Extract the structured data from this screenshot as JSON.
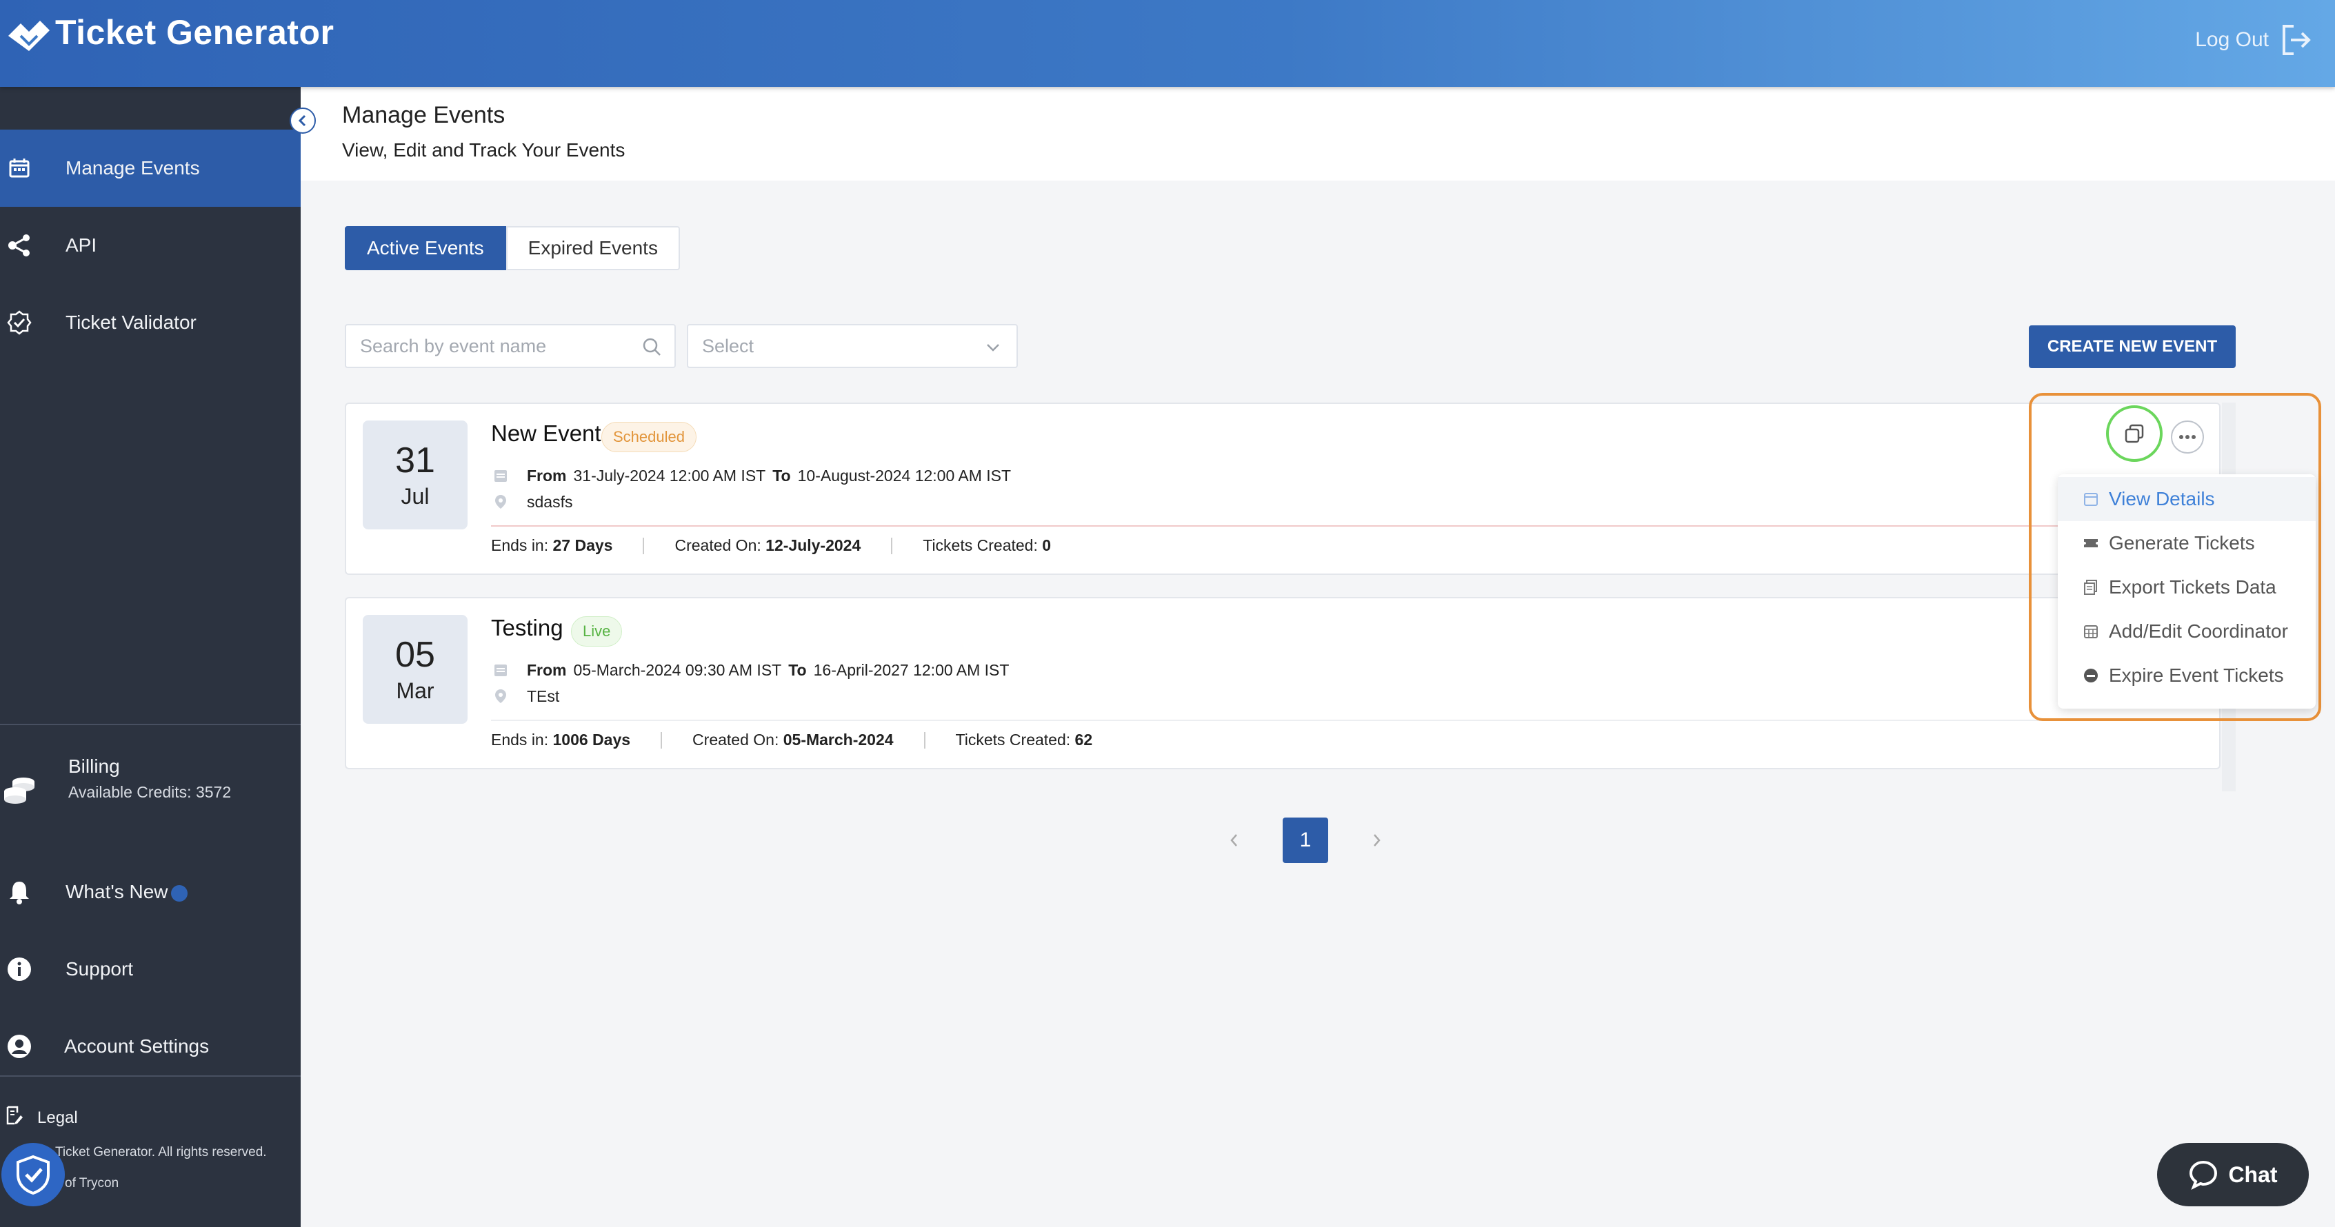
{
  "header": {
    "app_title": "Ticket Generator",
    "logout_label": "Log Out"
  },
  "sidebar": {
    "items": [
      {
        "label": "Manage Events",
        "icon": "calendar-icon",
        "active": true
      },
      {
        "label": "API",
        "icon": "share-nodes-icon",
        "active": false
      },
      {
        "label": "Ticket Validator",
        "icon": "badge-check-icon",
        "active": false
      }
    ],
    "billing": {
      "title": "Billing",
      "credits": "Available Credits: 3572",
      "icon": "coins-icon"
    },
    "bottom_items": [
      {
        "label": "What's New",
        "icon": "bell-icon"
      },
      {
        "label": "Support",
        "icon": "info-icon"
      },
      {
        "label": "Account Settings",
        "icon": "user-circle-icon"
      }
    ],
    "legal": "Legal",
    "copyright_line1": "Ticket Generator. All rights reserved.",
    "copyright_line2": "of Trycon"
  },
  "page": {
    "title": "Manage Events",
    "subtitle": "View, Edit and Track Your Events"
  },
  "tabs": [
    {
      "label": "Active Events",
      "active": true
    },
    {
      "label": "Expired Events",
      "active": false
    }
  ],
  "filters": {
    "search_placeholder": "Search by event name",
    "select_placeholder": "Select",
    "create_label": "CREATE NEW EVENT"
  },
  "events": [
    {
      "day": "31",
      "month": "Jul",
      "name": "New Event",
      "status": "Scheduled",
      "from_label": "From",
      "from": "31-July-2024 12:00 AM IST",
      "to_label": "To",
      "to": "10-August-2024 12:00 AM IST",
      "location": "sdasfs",
      "ends_label": "Ends in:",
      "ends_value": "27 Days",
      "created_label": "Created On:",
      "created_value": "12-July-2024",
      "tickets_label": "Tickets Created:",
      "tickets_value": "0"
    },
    {
      "day": "05",
      "month": "Mar",
      "name": "Testing",
      "status": "Live",
      "from_label": "From",
      "from": "05-March-2024 09:30 AM IST",
      "to_label": "To",
      "to": "16-April-2027 12:00 AM IST",
      "location": "TEst",
      "ends_label": "Ends in:",
      "ends_value": "1006 Days",
      "created_label": "Created On:",
      "created_value": "05-March-2024",
      "tickets_label": "Tickets Created:",
      "tickets_value": "62"
    }
  ],
  "action_menu": [
    {
      "label": "View Details",
      "icon": "calendar-icon",
      "highlighted": true
    },
    {
      "label": "Generate Tickets",
      "icon": "ticket-icon",
      "highlighted": false
    },
    {
      "label": "Export Tickets Data",
      "icon": "export-icon",
      "highlighted": false
    },
    {
      "label": "Add/Edit Coordinator",
      "icon": "calendar-grid-icon",
      "highlighted": false
    },
    {
      "label": "Expire Event Tickets",
      "icon": "minus-circle-icon",
      "highlighted": false
    }
  ],
  "pagination": {
    "current": "1"
  },
  "chat": {
    "label": "Chat"
  },
  "colors": {
    "primary": "#2d5ca8",
    "sidebar": "#2c3340",
    "scheduled": "#e2953b",
    "live": "#57b343",
    "highlight_box": "#e8913a",
    "copy_ring": "#6bd65c"
  }
}
